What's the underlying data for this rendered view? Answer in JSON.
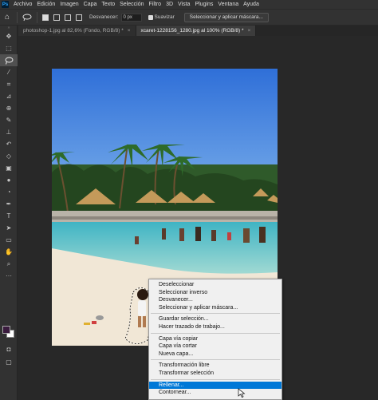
{
  "menubar": {
    "logo": "Ps",
    "items": [
      "Archivo",
      "Edición",
      "Imagen",
      "Capa",
      "Texto",
      "Selección",
      "Filtro",
      "3D",
      "Vista",
      "Plugins",
      "Ventana",
      "Ayuda"
    ]
  },
  "options": {
    "feather_label": "Desvanecer:",
    "feather_value": "0 px",
    "smooth_label": "Suavizar",
    "select_mask_button": "Seleccionar y aplicar máscara..."
  },
  "tabs": [
    {
      "label": "photoshop-1.jpg al 82,6% (Fondo, RGB/8) *",
      "close": "×"
    },
    {
      "label": "xcaret-1228156_1280.jpg al 100% (RGB/8) *",
      "close": "×"
    }
  ],
  "context_menu": {
    "groups": [
      [
        "Deseleccionar",
        "Seleccionar inverso",
        "Desvanecer...",
        "Seleccionar y aplicar máscara..."
      ],
      [
        "Guardar selección...",
        "Hacer trazado de trabajo..."
      ],
      [
        "Capa vía copiar",
        "Capa vía cortar",
        "Nueva capa..."
      ],
      [
        "Transformación libre",
        "Transformar selección"
      ],
      [
        "Rellenar...",
        "Contornear..."
      ]
    ],
    "highlighted": "Rellenar..."
  },
  "colors": {
    "foreground": "#3a1b3e",
    "background": "#ffffff",
    "highlight": "#0078d7"
  },
  "tools": [
    "move-icon",
    "marquee-icon",
    "lasso-icon",
    "magic-wand-icon",
    "crop-icon",
    "eyedropper-icon",
    "healing-icon",
    "brush-icon",
    "stamp-icon",
    "history-brush-icon",
    "eraser-icon",
    "gradient-icon",
    "blur-icon",
    "dodge-icon",
    "pen-icon",
    "type-icon",
    "path-select-icon",
    "shape-icon",
    "hand-icon",
    "zoom-icon",
    "more-icon"
  ]
}
